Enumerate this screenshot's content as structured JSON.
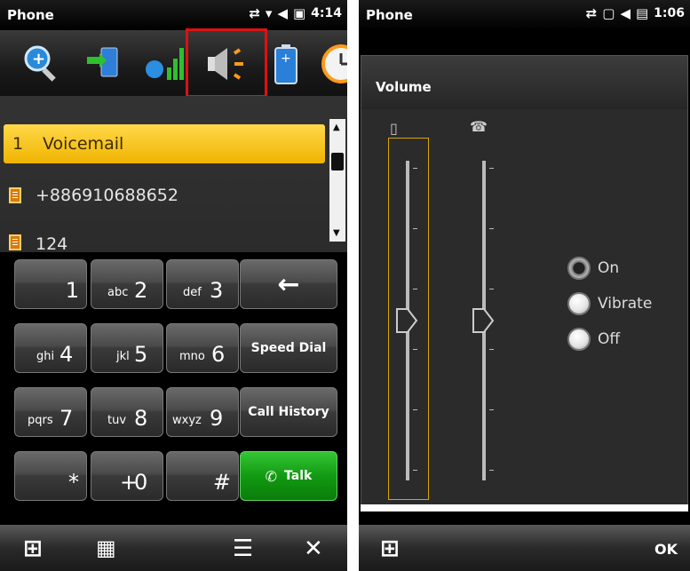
{
  "left_phone": {
    "title": "Phone",
    "status_time": "4:14",
    "toolbar": {
      "icons": [
        "zoom-in-icon",
        "connection-manager-icon",
        "signal-icon",
        "volume-icon",
        "battery-icon",
        "clock-icon"
      ]
    },
    "list": [
      {
        "num": "1",
        "label": "Voicemail",
        "selected": true
      },
      {
        "label": "+886910688652"
      },
      {
        "label": "124"
      }
    ],
    "keys": [
      {
        "sub": "",
        "main": "1"
      },
      {
        "sub": "abc",
        "main": "2"
      },
      {
        "sub": "def",
        "main": "3"
      },
      {
        "sub": "ghi",
        "main": "4"
      },
      {
        "sub": "jkl",
        "main": "5"
      },
      {
        "sub": "mno",
        "main": "6"
      },
      {
        "sub": "pqrs",
        "main": "7"
      },
      {
        "sub": "tuv",
        "main": "8"
      },
      {
        "sub": "wxyz",
        "main": "9"
      },
      {
        "sub": "",
        "main": "*"
      },
      {
        "sub": "+",
        "main": "0"
      },
      {
        "sub": "",
        "main": "#"
      }
    ],
    "actions": {
      "backspace": "←",
      "speed_dial": "Speed Dial",
      "call_history": "Call History",
      "talk": "Talk"
    }
  },
  "right_phone": {
    "title": "Phone",
    "status_time": "1:06",
    "dialog_title": "Volume",
    "sliders": {
      "system_volume_level": 0.5,
      "ringer_volume_level": 0.5
    },
    "radios": [
      {
        "label": "On",
        "checked": true
      },
      {
        "label": "Vibrate",
        "checked": false
      },
      {
        "label": "Off",
        "checked": false
      }
    ],
    "softkey_right": "OK"
  },
  "colors": {
    "highlight": "#e01010",
    "selection": "#f5c518",
    "talk": "#1aa51a",
    "slider_frame": "#d9a400"
  }
}
